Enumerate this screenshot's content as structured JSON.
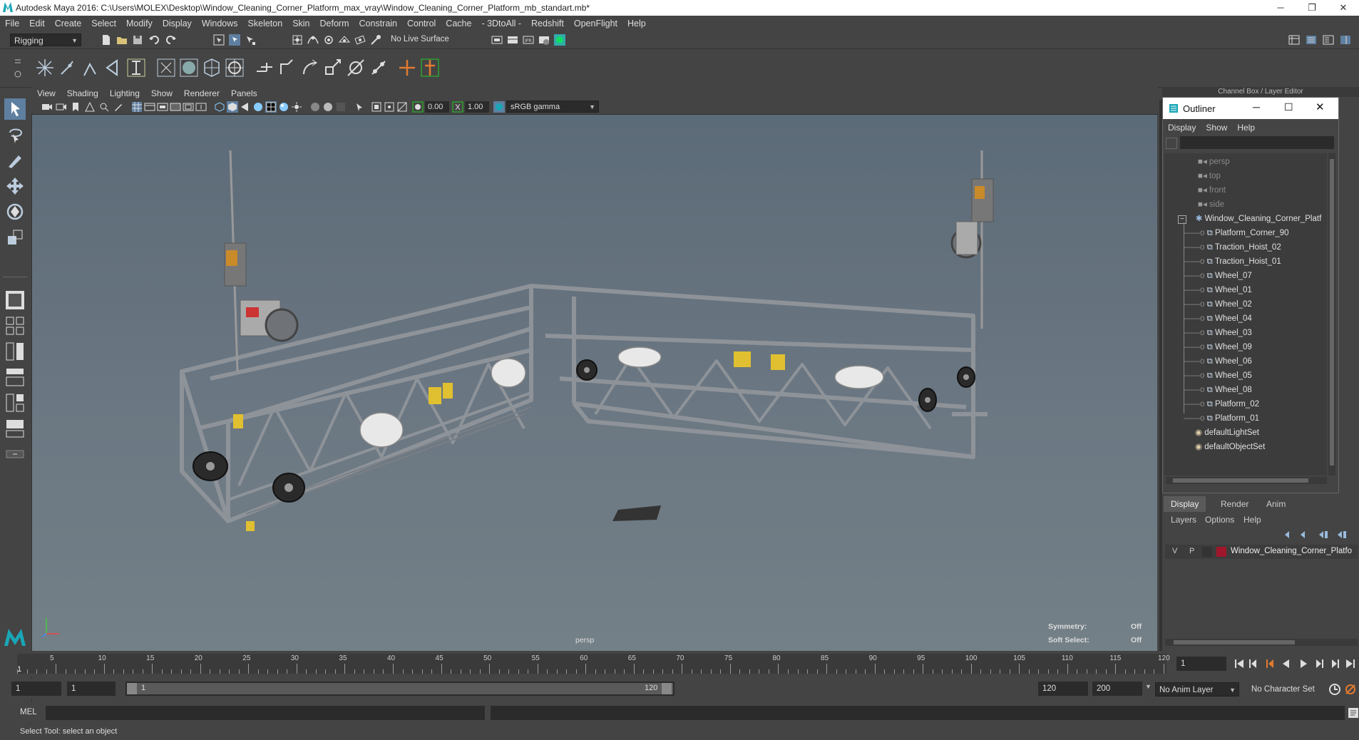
{
  "window": {
    "title": "Autodesk Maya 2016: C:\\Users\\MOLEX\\Desktop\\Window_Cleaning_Corner_Platform_max_vray\\Window_Cleaning_Corner_Platform_mb_standart.mb*",
    "minimize": "─",
    "maximize": "❐",
    "close": "✕"
  },
  "menubar": [
    "File",
    "Edit",
    "Create",
    "Select",
    "Modify",
    "Display",
    "Windows",
    "Skeleton",
    "Skin",
    "Deform",
    "Constrain",
    "Control",
    "Cache",
    "- 3DtoAll -",
    "Redshift",
    "OpenFlight",
    "Help"
  ],
  "statusline": {
    "menuset": "Rigging",
    "live_surface": "No Live Surface"
  },
  "panel": {
    "menus": [
      "View",
      "Shading",
      "Lighting",
      "Show",
      "Renderer",
      "Panels"
    ],
    "near_value": "0.00",
    "far_value": "1.00",
    "color_space": "sRGB gamma",
    "camera_label": "persp",
    "symmetry_label": "Symmetry:",
    "symmetry_value": "Off",
    "soft_select_label": "Soft Select:",
    "soft_select_value": "Off"
  },
  "channel_box": {
    "title": "Channel Box / Layer Editor"
  },
  "outliner": {
    "title": "Outliner",
    "menus": [
      "Display",
      "Show",
      "Help"
    ],
    "cameras": [
      "persp",
      "top",
      "front",
      "side"
    ],
    "group": "Window_Cleaning_Corner_Platf",
    "children": [
      "Platform_Corner_90",
      "Traction_Hoist_02",
      "Traction_Hoist_01",
      "Wheel_07",
      "Wheel_01",
      "Wheel_02",
      "Wheel_04",
      "Wheel_03",
      "Wheel_09",
      "Wheel_06",
      "Wheel_05",
      "Wheel_08",
      "Platform_02",
      "Platform_01"
    ],
    "sets": [
      "defaultLightSet",
      "defaultObjectSet"
    ]
  },
  "layer_editor": {
    "tabs": [
      "Display",
      "Render",
      "Anim"
    ],
    "menus": [
      "Layers",
      "Options",
      "Help"
    ],
    "layer": {
      "v": "V",
      "p": "P",
      "name": "Window_Cleaning_Corner_Platfo",
      "color": "#a0162a"
    }
  },
  "timeslider": {
    "ticks": [
      "5",
      "10",
      "15",
      "20",
      "25",
      "30",
      "35",
      "40",
      "45",
      "50",
      "55",
      "60",
      "65",
      "70",
      "75",
      "80",
      "85",
      "90",
      "95",
      "100",
      "105",
      "110",
      "115",
      "120"
    ],
    "start_marker": "1",
    "current_frame": "1"
  },
  "range": {
    "start": "1",
    "playback_start": "1",
    "range_start": "1",
    "range_end": "120",
    "playback_end": "120",
    "end": "200",
    "anim_layer": "No Anim Layer",
    "character_set": "No Character Set"
  },
  "cmdline": {
    "label": "MEL"
  },
  "helpline": {
    "text": "Select Tool: select an object"
  }
}
